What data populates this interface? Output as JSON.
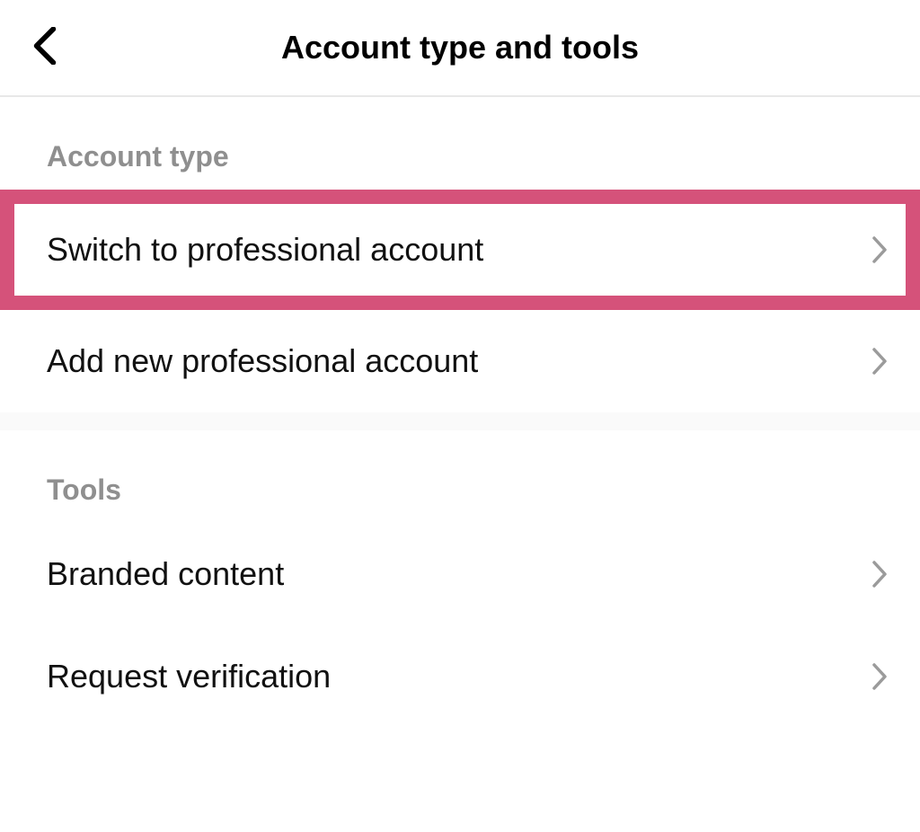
{
  "header": {
    "title": "Account type and tools"
  },
  "sections": {
    "account_type": {
      "header": "Account type",
      "items": [
        {
          "label": "Switch to professional account"
        },
        {
          "label": "Add new professional account"
        }
      ]
    },
    "tools": {
      "header": "Tools",
      "items": [
        {
          "label": "Branded content"
        },
        {
          "label": "Request verification"
        }
      ]
    }
  }
}
